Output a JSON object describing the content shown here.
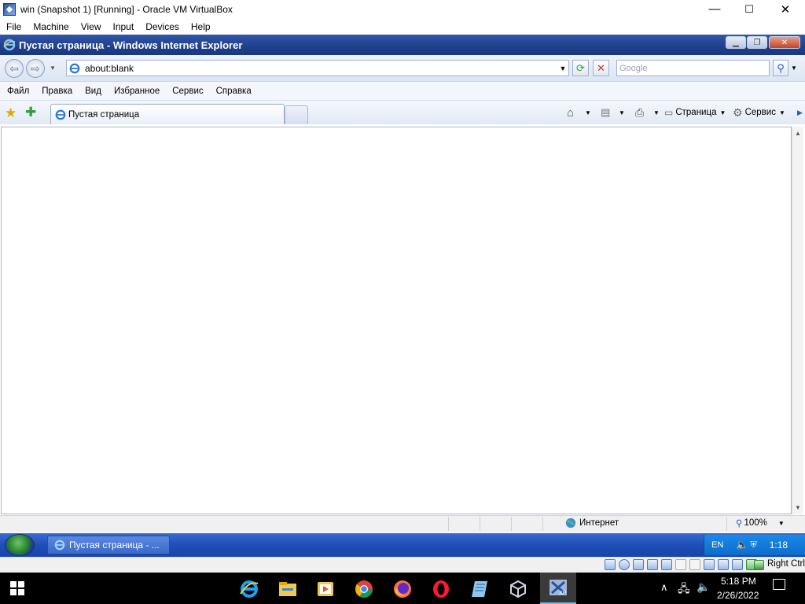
{
  "vbox": {
    "title": "win (Snapshot 1) [Running] - Oracle VM VirtualBox",
    "menu": [
      "File",
      "Machine",
      "View",
      "Input",
      "Devices",
      "Help"
    ],
    "controls": {
      "minimize": "—",
      "maximize": "☐",
      "close": "✕"
    },
    "host_key": "Right Ctrl"
  },
  "ie": {
    "title": "Пустая страница - Windows Internet Explorer",
    "address": "about:blank",
    "search_placeholder": "Google",
    "menu": [
      "Файл",
      "Правка",
      "Вид",
      "Избранное",
      "Сервис",
      "Справка"
    ],
    "tab_label": "Пустая страница",
    "toolbar": {
      "page_label": "Страница",
      "tools_label": "Сервис"
    },
    "status": {
      "zone": "Интернет",
      "zoom": "100%"
    }
  },
  "xp_taskbar": {
    "task_label": "Пустая страница - ...",
    "lang": "EN",
    "time": "1:18"
  },
  "win10_taskbar": {
    "apps": [
      "internet-explorer",
      "file-explorer",
      "media-player",
      "chrome",
      "firefox",
      "opera",
      "notepad",
      "virtualbox",
      "virtualbox-xp"
    ],
    "time": "5:18 PM",
    "date": "2/26/2022"
  },
  "colors": {
    "ie_title": "#20408c",
    "xp_taskbar": "#1e4fb8",
    "xp_tray": "#0f6ccb"
  }
}
